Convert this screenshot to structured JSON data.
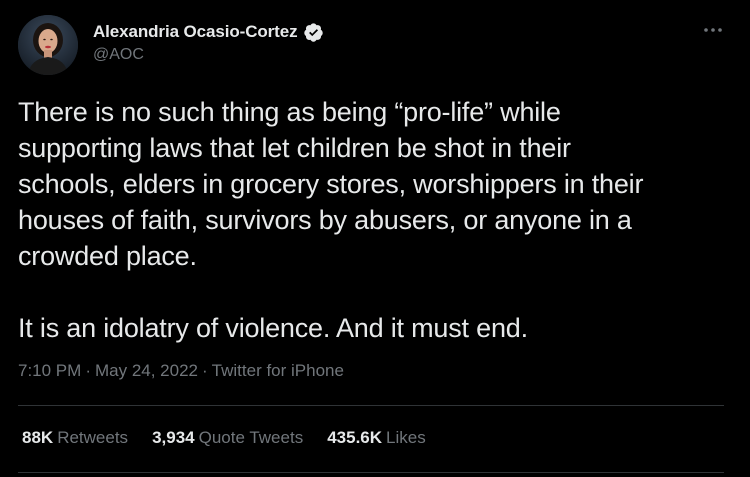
{
  "author": {
    "display_name": "Alexandria Ocasio-Cortez",
    "handle": "@AOC",
    "verified": true,
    "avatar_icon": "profile-photo"
  },
  "menu_icon": "more-horizontal-icon",
  "tweet": {
    "paragraphs": [
      "There is no such thing as being “pro-life” while\nsupporting laws that let children be shot in their\nschools, elders in grocery stores, worshippers in their\nhouses of faith, survivors by abusers, or anyone in a\ncrowded place.",
      "It is an idolatry of violence. And it must end."
    ]
  },
  "meta": {
    "time": "7:10 PM",
    "separator": "·",
    "date": "May 24, 2022",
    "source": "Twitter for iPhone"
  },
  "stats": {
    "retweets": {
      "count": "88K",
      "label": "Retweets"
    },
    "quotes": {
      "count": "3,934",
      "label": "Quote Tweets"
    },
    "likes": {
      "count": "435.6K",
      "label": "Likes"
    }
  },
  "colors": {
    "background": "#000000",
    "text_primary": "#e7e9ea",
    "text_secondary": "#71767b",
    "divider": "#2f3336",
    "verified_badge": "#e7e9ea"
  }
}
